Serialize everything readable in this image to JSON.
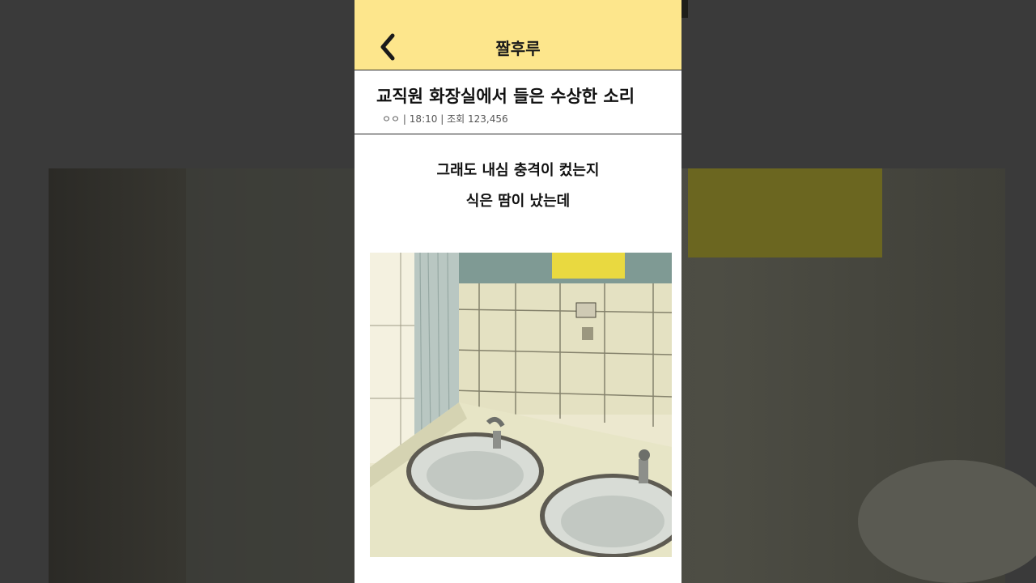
{
  "app": {
    "title": "짤후루"
  },
  "post": {
    "title": "교직원 화장실에서 들은 수상한 소리",
    "author": "ㅇㅇ",
    "time": "18:10",
    "views_label": "조회 123,456",
    "separator": "|",
    "body_lines": [
      "그래도 내심 충격이 컸는지",
      "식은 땀이 났는데"
    ]
  },
  "icons": {
    "back": "chevron-left-icon"
  },
  "colors": {
    "header_bg": "#fde68c",
    "page_bg": "#ffffff",
    "backdrop": "#3a3a3a"
  }
}
